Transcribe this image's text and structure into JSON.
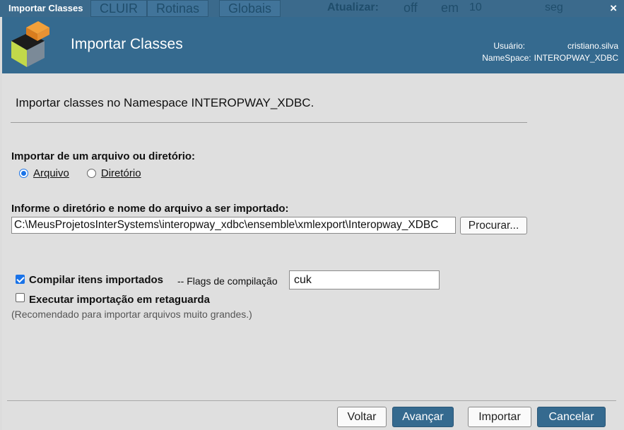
{
  "background_toolbar": {
    "items": [
      "CLUIR",
      "Rotinas",
      "Globais",
      "Atualizar:",
      "off",
      "em",
      "10",
      "seg"
    ]
  },
  "window": {
    "title": "Importar Classes",
    "close_label": "×"
  },
  "header": {
    "title": "Importar Classes",
    "user_label": "Usuário:",
    "user_value": "cristiano.silva",
    "namespace_label": "NameSpace:",
    "namespace_value": "INTEROPWAY_XDBC"
  },
  "form": {
    "description": "Importar classes no Namespace INTEROPWAY_XDBC.",
    "source_label": "Importar de um arquivo ou diretório:",
    "source_options": [
      {
        "label": "Arquivo",
        "selected": true
      },
      {
        "label": "Diretório",
        "selected": false
      }
    ],
    "path_label": "Informe o diretório e nome do arquivo a ser importado:",
    "path_value": "C:\\MeusProjetosInterSystems\\interopway_xdbc\\ensemble\\xmlexport\\Interopway_XDBC",
    "browse_button": "Procurar...",
    "compile_label": "Compilar itens importados",
    "compile_checked": true,
    "flags_label": "-- Flags de compilação",
    "flags_value": "cuk",
    "background_label": "Executar importação em retaguarda",
    "background_checked": false,
    "background_note": "(Recomendado para importar arquivos muito grandes.)"
  },
  "footer": {
    "back_button": "Voltar",
    "next_button": "Avançar",
    "import_button": "Importar",
    "cancel_button": "Cancelar"
  },
  "colors": {
    "header_bg": "#356a8f",
    "primary_button": "#356a8f",
    "accent": "#1a73e8"
  }
}
